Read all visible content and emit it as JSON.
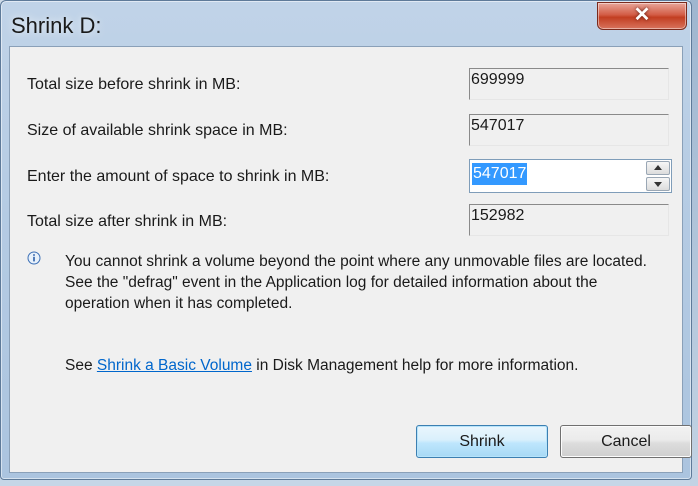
{
  "window": {
    "title": "Shrink D:",
    "close_glyph": "✕"
  },
  "fields": {
    "total_before": {
      "label": "Total size before shrink in MB:",
      "value": "699999"
    },
    "available": {
      "label": "Size of available shrink space in MB:",
      "value": "547017"
    },
    "amount": {
      "label": "Enter the amount of space to shrink in MB:",
      "value": "547017"
    },
    "total_after": {
      "label": "Total size after shrink in MB:",
      "value": "152982"
    }
  },
  "info": {
    "icon": "info-icon",
    "text": "You cannot shrink a volume beyond the point where any unmovable files are located. See the \"defrag\" event in the Application log for detailed information about the operation when it has completed."
  },
  "help": {
    "prefix": "See ",
    "link": "Shrink a Basic Volume",
    "suffix": " in Disk Management help for more information."
  },
  "buttons": {
    "shrink": "Shrink",
    "cancel": "Cancel"
  },
  "colors": {
    "selection": "#3399ff",
    "link": "#0066cc",
    "close_red": "#c23e22"
  }
}
